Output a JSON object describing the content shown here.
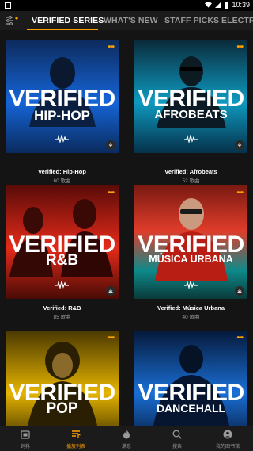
{
  "status": {
    "time": "10:39"
  },
  "tabs": [
    {
      "label": "VERIFIED SERIES",
      "active": true
    },
    {
      "label": "WHAT'S NEW",
      "active": false
    },
    {
      "label": "STAFF PICKS",
      "active": false
    },
    {
      "label": "ELECTRO",
      "active": false
    }
  ],
  "playlists": [
    {
      "cover_word": "VERIFIED",
      "cover_genre": "HIP-HOP",
      "title": "Verified: Hip-Hop",
      "subtitle": "60 歌曲",
      "colors": [
        "#1565d8",
        "#0a2b5e"
      ]
    },
    {
      "cover_word": "VERIFIED",
      "cover_genre": "AFROBEATS",
      "title": "Verified: Afrobeats",
      "subtitle": "52 歌曲",
      "colors": [
        "#0e9ac0",
        "#06314a"
      ]
    },
    {
      "cover_word": "VERIFIED",
      "cover_genre": "R&B",
      "title": "Verified: R&B",
      "subtitle": "85 歌曲",
      "colors": [
        "#e52a1a",
        "#4a0b06"
      ]
    },
    {
      "cover_word": "VERIFIED",
      "cover_genre": "MÚSICA URBANA",
      "title": "Verified: Música Urbana",
      "subtitle": "40 歌曲",
      "colors": [
        "#e03c2a",
        "#0e8a8a"
      ]
    },
    {
      "cover_word": "VERIFIED",
      "cover_genre": "POP",
      "title": "",
      "subtitle": "",
      "colors": [
        "#e6b400",
        "#3a2c00"
      ]
    },
    {
      "cover_word": "VERIFIED",
      "cover_genre": "DANCEHALL",
      "title": "",
      "subtitle": "",
      "colors": [
        "#1a6fd6",
        "#05193a"
      ]
    }
  ],
  "nav": [
    {
      "label": "饲料",
      "icon": "feed-icon",
      "active": false
    },
    {
      "label": "播放列表",
      "icon": "playlist-icon",
      "active": true
    },
    {
      "label": "满意",
      "icon": "flame-icon",
      "active": false
    },
    {
      "label": "搜索",
      "icon": "search-icon",
      "active": false
    },
    {
      "label": "我的图书馆",
      "icon": "library-icon",
      "active": false
    }
  ],
  "colors": {
    "accent": "#ffa200",
    "background": "#141414",
    "bar": "#1b1b1b"
  }
}
